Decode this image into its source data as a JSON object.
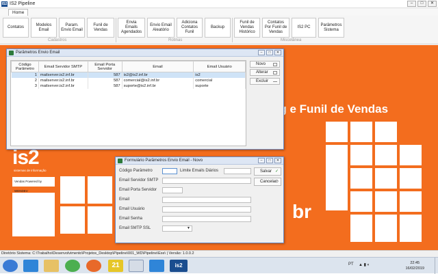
{
  "window": {
    "title": "IS2 Pipeline",
    "logo": "IS2",
    "controls": [
      "minimize-icon",
      "maximize-icon",
      "close-icon"
    ]
  },
  "ribbon_tab": "Home",
  "ribbon_buttons": [
    {
      "label": "Contatos"
    },
    {
      "label": "Modelos Email"
    },
    {
      "label": "Param. Envio Email"
    },
    {
      "label": "Funil de Vendas"
    },
    {
      "label": "Envia Emails Agendados"
    },
    {
      "label": "Envio Email Aleatório"
    },
    {
      "label": "Adiciona Contatos Funil"
    },
    {
      "label": "Backup"
    },
    {
      "label": "Funil de Vendas Histórico"
    },
    {
      "label": "Contatos Por Funil de Vendas"
    },
    {
      "label": "IS2 PC"
    },
    {
      "label": "Parâmetros Sistema"
    }
  ],
  "ribbon_groups": [
    "Cadastros",
    "Rotinas",
    "Miscelânea"
  ],
  "background": {
    "headline": "ng e Funil de Vendas",
    "domain_fragment": "br",
    "logo": "is2",
    "logo_sub": "sistemas de informação",
    "vendas_text": "Vendas Powered by WENDEV",
    "brand_color": "#f36d1e"
  },
  "params_window": {
    "title": "Parâmetros Envio Email",
    "columns": [
      "Código Parâmetro",
      "Email Servidor SMTP",
      "Email Porta Servidor",
      "Email",
      "Email Usuário"
    ],
    "rows": [
      {
        "codigo": "1",
        "smtp": "mailserver.is2.inf.br",
        "porta": "587",
        "email": "is2@is2.inf.br",
        "usuario": "is2"
      },
      {
        "codigo": "2",
        "smtp": "mailserver.is2.inf.br",
        "porta": "587",
        "email": "comercial@is2.inf.br",
        "usuario": "comercial"
      },
      {
        "codigo": "3",
        "smtp": "mailserver.is2.inf.br",
        "porta": "587",
        "email": "suporte@is2.inf.br",
        "usuario": "suporte"
      }
    ],
    "selected_row": 0,
    "buttons": {
      "novo": "Novo",
      "alterar": "Alterar",
      "excluir": "Excluir"
    }
  },
  "form_window": {
    "title": "Formulário Parâmetros Envio Email - Novo",
    "labels": {
      "codigo": "Código Parâmetro",
      "limite": "Limite Emails Diários",
      "smtp": "Email Servidor SMTP",
      "porta": "Email Porta Servidor",
      "email": "Email",
      "usuario": "Email Usuário",
      "senha": "Email Senha",
      "ssl": "Email SMTP SSL"
    },
    "buttons": {
      "salvar": "Salvar",
      "cancelar": "Cancelar"
    }
  },
  "status_bar": "Diretório Sistema: C:\\Trabalho\\Desenvolvimento\\Projetos_Desktop\\Pipeline\\001_WD\\Pipeline\\Exe\\ | Versão: 1.0.0.2",
  "taskbar": {
    "language": "PT",
    "time": "22:45",
    "date": "16/02/2019",
    "pinned": [
      "start-icon",
      "ie-icon",
      "explorer-icon",
      "chrome-icon",
      "firefox-icon",
      "badge-21-icon",
      "windev-icon",
      "ie2-icon",
      "is2-app-icon"
    ],
    "badge_label": "21",
    "is2_label": "is2"
  }
}
